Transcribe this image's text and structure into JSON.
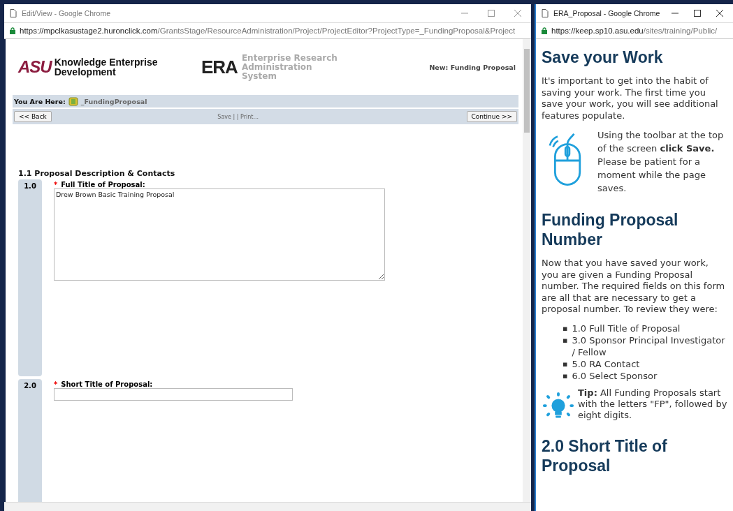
{
  "left_window": {
    "title": "Edit/View - Google Chrome",
    "url_host": "https://mpclkasustage2.huronclick.com",
    "url_path": "/GrantsStage/ResourceAdministration/Project/ProjectEditor?ProjectType=_FundingProposal&Project",
    "header": {
      "asu_logo": "ASU",
      "asu_unit": "Knowledge Enterprise Development",
      "era_logo": "ERA",
      "era_name": "Enterprise Research Administration System",
      "page_label": "New: Funding Proposal"
    },
    "breadcrumb": {
      "label": "You Are Here:",
      "item": "_FundingProposal"
    },
    "toolbar": {
      "back": "<< Back",
      "links": "Save | | Print...",
      "continue": "Continue >>"
    },
    "section_title": "1.1 Proposal Description & Contacts",
    "questions": [
      {
        "number": "1.0",
        "label": "Full Title of Proposal:",
        "required_mark": "*",
        "kind": "textarea",
        "value": "Drew Brown Basic Training Proposal"
      },
      {
        "number": "2.0",
        "label": "Short Title of Proposal:",
        "required_mark": "*",
        "kind": "text"
      }
    ]
  },
  "right_window": {
    "title": "ERA_Proposal - Google Chrome",
    "url_host": "https://keep.sp10.asu.edu",
    "url_path": "/sites/training/Public/",
    "blocks": [
      {
        "kind": "heading",
        "text": "Save your Work"
      },
      {
        "kind": "paragraph",
        "text": "It's important to get into the habit of saving your work. The first time you save your work, you will see additional features populate."
      },
      {
        "kind": "mouse_note",
        "text": "Using the toolbar at the top of the screen **click Save.** Please be patient for a moment while the page saves."
      },
      {
        "kind": "heading",
        "text": "Funding Proposal Number"
      },
      {
        "kind": "paragraph",
        "text": "Now that you have saved your work, you are given a Funding Proposal number.  The required fields on this form are all that are necessary to get a proposal number.  To review they were:"
      },
      {
        "kind": "list",
        "marker": "▪",
        "items": [
          "1.0 Full Title of Proposal",
          "3.0 Sponsor Principal Investigator / Fellow",
          "5.0 RA Contact",
          "6.0 Select Sponsor"
        ]
      },
      {
        "kind": "tip",
        "text": "**Tip:** All Funding Proposals start with the letters \"FP\", followed by eight digits."
      },
      {
        "kind": "heading",
        "text": "2.0 Short Title of Proposal"
      }
    ]
  }
}
